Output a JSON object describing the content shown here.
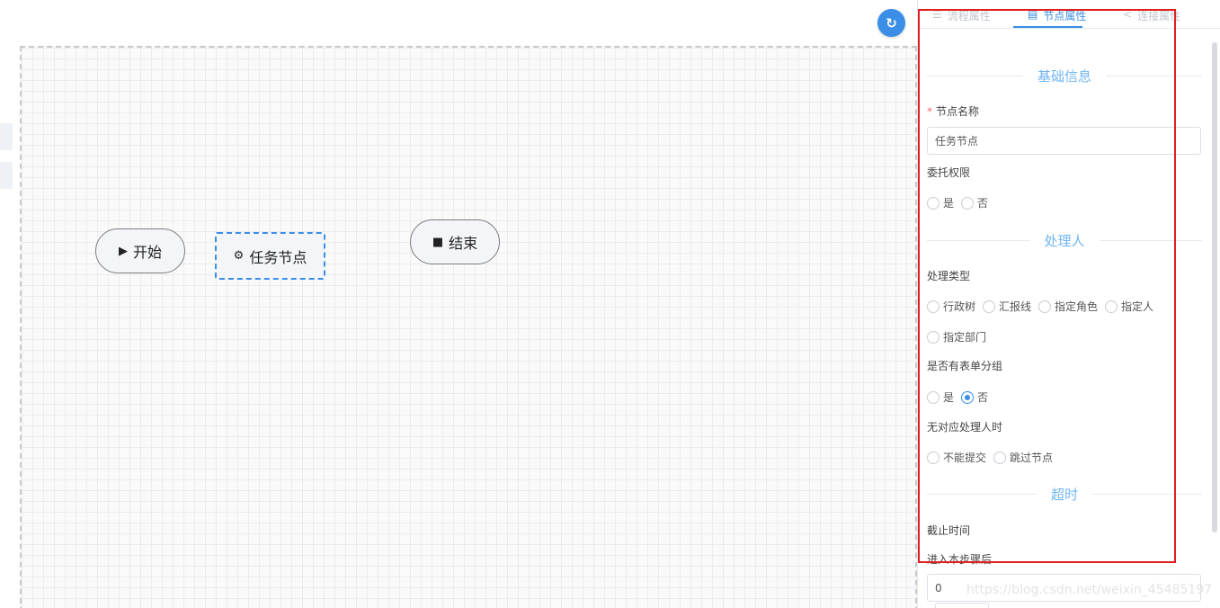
{
  "flow": {
    "start_label": "开始",
    "task_label": "任务节点",
    "end_label": "结束",
    "start_icon": "play-icon",
    "task_icon": "gear-icon",
    "end_icon": "stop-icon",
    "refresh_icon": "refresh-icon"
  },
  "panel": {
    "tabs": [
      {
        "label": "流程属性",
        "icon": "list-icon"
      },
      {
        "label": "节点属性",
        "icon": "document-icon"
      },
      {
        "label": "连接属性",
        "icon": "share-icon"
      }
    ],
    "active_tab": "节点属性",
    "sections": {
      "basic": "基础信息",
      "handler": "处理人",
      "timeout": "超时"
    },
    "node_name_label": "节点名称",
    "node_name_value": "任务节点",
    "delegate_label": "委托权限",
    "delegate_options": [
      "是",
      "否"
    ],
    "handler_type_label": "处理类型",
    "handler_type_options": [
      "行政树",
      "汇报线",
      "指定角色",
      "指定人",
      "指定部门"
    ],
    "form_group_label": "是否有表单分组",
    "form_group_options": [
      "是",
      "否"
    ],
    "form_group_selected": "否",
    "no_handler_label": "无对应处理人时",
    "no_handler_options": [
      "不能提交",
      "跳过节点"
    ],
    "deadline_label": "截止时间",
    "after_enter_label": "进入本步骤后",
    "deadline_value": "0"
  },
  "watermark": "https://blog.csdn.net/weixin_45485197",
  "colors": {
    "accent": "#3a8ee6",
    "section_title": "#6fb5f5",
    "highlight_border": "#e02020",
    "required": "#f56c6c"
  }
}
